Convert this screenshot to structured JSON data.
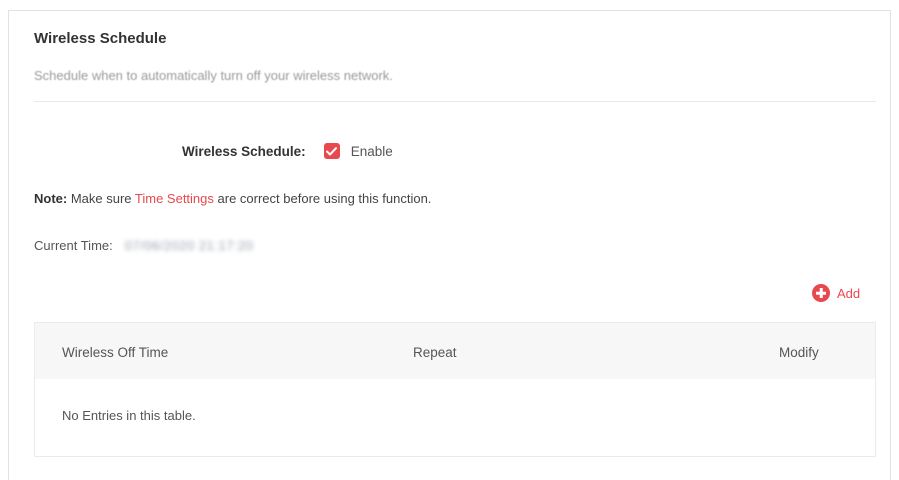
{
  "section": {
    "title": "Wireless Schedule",
    "description": "Schedule when to automatically turn off your wireless network."
  },
  "schedule": {
    "label": "Wireless Schedule:",
    "enabled": true,
    "enable_label": "Enable",
    "checkbox_color": "#e8494f"
  },
  "note": {
    "prefix": "Note:",
    "text_before": " Make sure ",
    "link": "Time Settings",
    "text_after": " are correct before using this function."
  },
  "current_time": {
    "label": "Current Time:",
    "value": "07/06/2020 21:17:20"
  },
  "add_button": {
    "icon": "plus-circle-icon",
    "label": "Add"
  },
  "table": {
    "columns": [
      "Wireless Off Time",
      "Repeat",
      "Modify"
    ],
    "empty_message": "No Entries in this table."
  },
  "colors": {
    "accent": "#e8494f"
  }
}
